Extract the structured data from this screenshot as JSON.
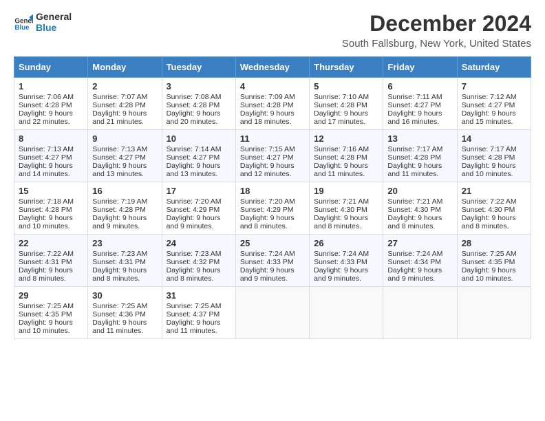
{
  "header": {
    "logo_line1": "General",
    "logo_line2": "Blue",
    "title": "December 2024",
    "subtitle": "South Fallsburg, New York, United States"
  },
  "days": [
    "Sunday",
    "Monday",
    "Tuesday",
    "Wednesday",
    "Thursday",
    "Friday",
    "Saturday"
  ],
  "weeks": [
    [
      {
        "day": "1",
        "sunrise": "Sunrise: 7:06 AM",
        "sunset": "Sunset: 4:28 PM",
        "daylight": "Daylight: 9 hours and 22 minutes."
      },
      {
        "day": "2",
        "sunrise": "Sunrise: 7:07 AM",
        "sunset": "Sunset: 4:28 PM",
        "daylight": "Daylight: 9 hours and 21 minutes."
      },
      {
        "day": "3",
        "sunrise": "Sunrise: 7:08 AM",
        "sunset": "Sunset: 4:28 PM",
        "daylight": "Daylight: 9 hours and 20 minutes."
      },
      {
        "day": "4",
        "sunrise": "Sunrise: 7:09 AM",
        "sunset": "Sunset: 4:28 PM",
        "daylight": "Daylight: 9 hours and 18 minutes."
      },
      {
        "day": "5",
        "sunrise": "Sunrise: 7:10 AM",
        "sunset": "Sunset: 4:28 PM",
        "daylight": "Daylight: 9 hours and 17 minutes."
      },
      {
        "day": "6",
        "sunrise": "Sunrise: 7:11 AM",
        "sunset": "Sunset: 4:27 PM",
        "daylight": "Daylight: 9 hours and 16 minutes."
      },
      {
        "day": "7",
        "sunrise": "Sunrise: 7:12 AM",
        "sunset": "Sunset: 4:27 PM",
        "daylight": "Daylight: 9 hours and 15 minutes."
      }
    ],
    [
      {
        "day": "8",
        "sunrise": "Sunrise: 7:13 AM",
        "sunset": "Sunset: 4:27 PM",
        "daylight": "Daylight: 9 hours and 14 minutes."
      },
      {
        "day": "9",
        "sunrise": "Sunrise: 7:13 AM",
        "sunset": "Sunset: 4:27 PM",
        "daylight": "Daylight: 9 hours and 13 minutes."
      },
      {
        "day": "10",
        "sunrise": "Sunrise: 7:14 AM",
        "sunset": "Sunset: 4:27 PM",
        "daylight": "Daylight: 9 hours and 13 minutes."
      },
      {
        "day": "11",
        "sunrise": "Sunrise: 7:15 AM",
        "sunset": "Sunset: 4:27 PM",
        "daylight": "Daylight: 9 hours and 12 minutes."
      },
      {
        "day": "12",
        "sunrise": "Sunrise: 7:16 AM",
        "sunset": "Sunset: 4:28 PM",
        "daylight": "Daylight: 9 hours and 11 minutes."
      },
      {
        "day": "13",
        "sunrise": "Sunrise: 7:17 AM",
        "sunset": "Sunset: 4:28 PM",
        "daylight": "Daylight: 9 hours and 11 minutes."
      },
      {
        "day": "14",
        "sunrise": "Sunrise: 7:17 AM",
        "sunset": "Sunset: 4:28 PM",
        "daylight": "Daylight: 9 hours and 10 minutes."
      }
    ],
    [
      {
        "day": "15",
        "sunrise": "Sunrise: 7:18 AM",
        "sunset": "Sunset: 4:28 PM",
        "daylight": "Daylight: 9 hours and 10 minutes."
      },
      {
        "day": "16",
        "sunrise": "Sunrise: 7:19 AM",
        "sunset": "Sunset: 4:28 PM",
        "daylight": "Daylight: 9 hours and 9 minutes."
      },
      {
        "day": "17",
        "sunrise": "Sunrise: 7:20 AM",
        "sunset": "Sunset: 4:29 PM",
        "daylight": "Daylight: 9 hours and 9 minutes."
      },
      {
        "day": "18",
        "sunrise": "Sunrise: 7:20 AM",
        "sunset": "Sunset: 4:29 PM",
        "daylight": "Daylight: 9 hours and 8 minutes."
      },
      {
        "day": "19",
        "sunrise": "Sunrise: 7:21 AM",
        "sunset": "Sunset: 4:30 PM",
        "daylight": "Daylight: 9 hours and 8 minutes."
      },
      {
        "day": "20",
        "sunrise": "Sunrise: 7:21 AM",
        "sunset": "Sunset: 4:30 PM",
        "daylight": "Daylight: 9 hours and 8 minutes."
      },
      {
        "day": "21",
        "sunrise": "Sunrise: 7:22 AM",
        "sunset": "Sunset: 4:30 PM",
        "daylight": "Daylight: 9 hours and 8 minutes."
      }
    ],
    [
      {
        "day": "22",
        "sunrise": "Sunrise: 7:22 AM",
        "sunset": "Sunset: 4:31 PM",
        "daylight": "Daylight: 9 hours and 8 minutes."
      },
      {
        "day": "23",
        "sunrise": "Sunrise: 7:23 AM",
        "sunset": "Sunset: 4:31 PM",
        "daylight": "Daylight: 9 hours and 8 minutes."
      },
      {
        "day": "24",
        "sunrise": "Sunrise: 7:23 AM",
        "sunset": "Sunset: 4:32 PM",
        "daylight": "Daylight: 9 hours and 8 minutes."
      },
      {
        "day": "25",
        "sunrise": "Sunrise: 7:24 AM",
        "sunset": "Sunset: 4:33 PM",
        "daylight": "Daylight: 9 hours and 9 minutes."
      },
      {
        "day": "26",
        "sunrise": "Sunrise: 7:24 AM",
        "sunset": "Sunset: 4:33 PM",
        "daylight": "Daylight: 9 hours and 9 minutes."
      },
      {
        "day": "27",
        "sunrise": "Sunrise: 7:24 AM",
        "sunset": "Sunset: 4:34 PM",
        "daylight": "Daylight: 9 hours and 9 minutes."
      },
      {
        "day": "28",
        "sunrise": "Sunrise: 7:25 AM",
        "sunset": "Sunset: 4:35 PM",
        "daylight": "Daylight: 9 hours and 10 minutes."
      }
    ],
    [
      {
        "day": "29",
        "sunrise": "Sunrise: 7:25 AM",
        "sunset": "Sunset: 4:35 PM",
        "daylight": "Daylight: 9 hours and 10 minutes."
      },
      {
        "day": "30",
        "sunrise": "Sunrise: 7:25 AM",
        "sunset": "Sunset: 4:36 PM",
        "daylight": "Daylight: 9 hours and 11 minutes."
      },
      {
        "day": "31",
        "sunrise": "Sunrise: 7:25 AM",
        "sunset": "Sunset: 4:37 PM",
        "daylight": "Daylight: 9 hours and 11 minutes."
      },
      null,
      null,
      null,
      null
    ]
  ]
}
